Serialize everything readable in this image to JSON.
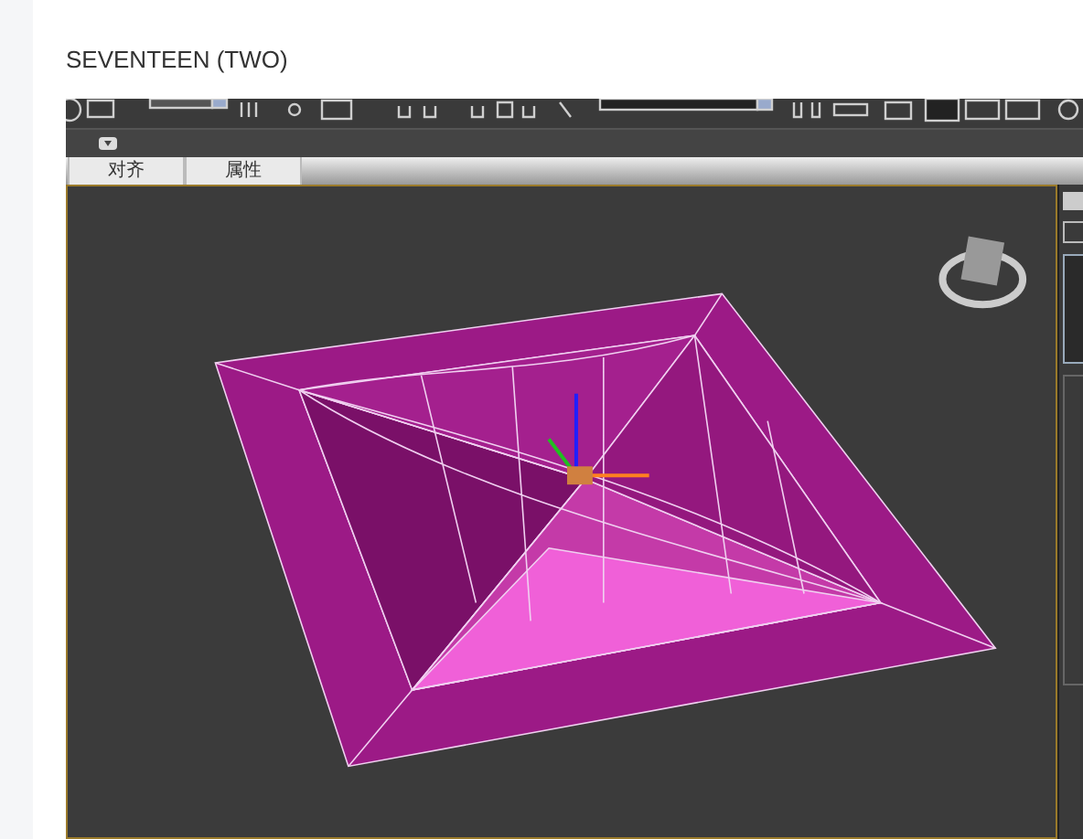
{
  "heading": "SEVENTEEN (TWO)",
  "tabs": [
    {
      "label": "对齐",
      "selected": false
    },
    {
      "label": "属性",
      "selected": false
    }
  ]
}
